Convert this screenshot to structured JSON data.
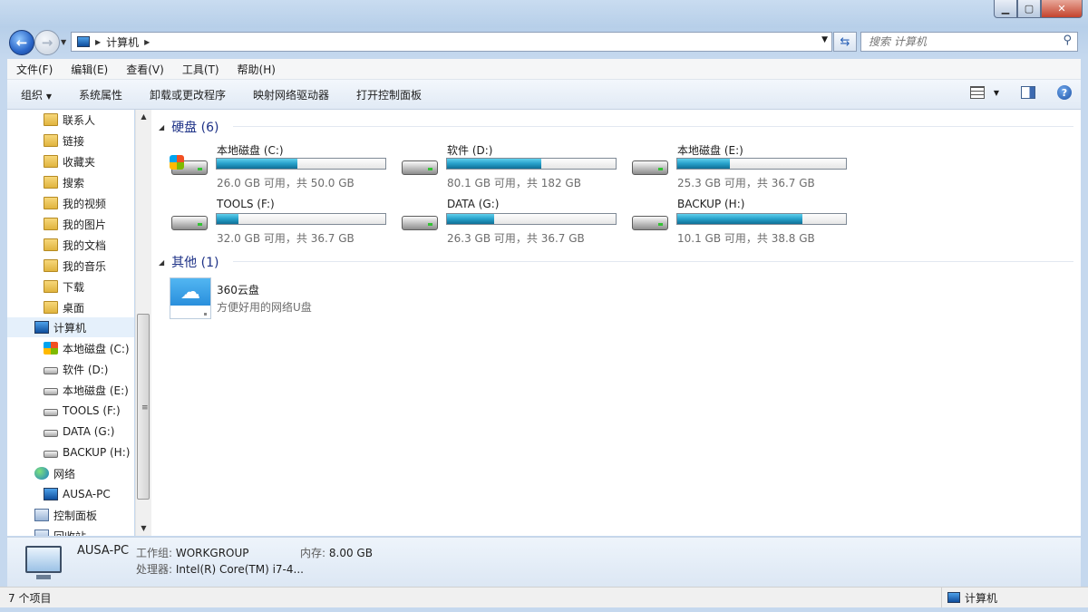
{
  "address": {
    "crumb": "计算机"
  },
  "search": {
    "placeholder": "搜索 计算机"
  },
  "menu": [
    "文件(F)",
    "编辑(E)",
    "查看(V)",
    "工具(T)",
    "帮助(H)"
  ],
  "commands": {
    "organize": "组织",
    "items": [
      "系统属性",
      "卸载或更改程序",
      "映射网络驱动器",
      "打开控制面板"
    ]
  },
  "nav": {
    "items": [
      {
        "label": "联系人",
        "icon": "contacts-icon"
      },
      {
        "label": "链接",
        "icon": "links-icon"
      },
      {
        "label": "收藏夹",
        "icon": "favorites-icon"
      },
      {
        "label": "搜索",
        "icon": "search-folder-icon"
      },
      {
        "label": "我的视频",
        "icon": "videos-icon"
      },
      {
        "label": "我的图片",
        "icon": "pictures-icon"
      },
      {
        "label": "我的文档",
        "icon": "documents-icon"
      },
      {
        "label": "我的音乐",
        "icon": "music-icon"
      },
      {
        "label": "下载",
        "icon": "downloads-icon"
      },
      {
        "label": "桌面",
        "icon": "desktop-icon"
      },
      {
        "label": "计算机",
        "icon": "computer-icon"
      },
      {
        "label": "本地磁盘 (C:)",
        "icon": "system-drive-icon"
      },
      {
        "label": "软件 (D:)",
        "icon": "drive-icon"
      },
      {
        "label": "本地磁盘 (E:)",
        "icon": "drive-icon"
      },
      {
        "label": "TOOLS (F:)",
        "icon": "drive-icon"
      },
      {
        "label": "DATA (G:)",
        "icon": "drive-icon"
      },
      {
        "label": "BACKUP (H:)",
        "icon": "drive-icon"
      },
      {
        "label": "网络",
        "icon": "network-icon"
      },
      {
        "label": "AUSA-PC",
        "icon": "computer-icon"
      },
      {
        "label": "控制面板",
        "icon": "control-panel-icon"
      },
      {
        "label": "回收站",
        "icon": "recycle-bin-icon"
      }
    ]
  },
  "groups": {
    "hard_disks": "硬盘 (6)",
    "other": "其他 (1)"
  },
  "drives": [
    {
      "name": "本地磁盘 (C:)",
      "free": "26.0 GB 可用，共 50.0 GB",
      "used_fraction": 0.48
    },
    {
      "name": "软件 (D:)",
      "free": "80.1 GB 可用，共 182 GB",
      "used_fraction": 0.56
    },
    {
      "name": "本地磁盘 (E:)",
      "free": "25.3 GB 可用，共 36.7 GB",
      "used_fraction": 0.31
    },
    {
      "name": "TOOLS (F:)",
      "free": "32.0 GB 可用，共 36.7 GB",
      "used_fraction": 0.13
    },
    {
      "name": "DATA (G:)",
      "free": "26.3 GB 可用，共 36.7 GB",
      "used_fraction": 0.28
    },
    {
      "name": "BACKUP (H:)",
      "free": "10.1 GB 可用，共 38.8 GB",
      "used_fraction": 0.74
    }
  ],
  "cloud": {
    "name": "360云盘",
    "desc": "方便好用的网络U盘"
  },
  "details": {
    "name": "AUSA-PC",
    "workgroup_label": "工作组:",
    "workgroup": "WORKGROUP",
    "memory_label": "内存:",
    "memory": "8.00 GB",
    "cpu_label": "处理器:",
    "cpu": "Intel(R) Core(TM) i7-4..."
  },
  "status": {
    "count": "7 个项目",
    "location": "计算机"
  },
  "colors": {
    "drive_fill": "#26a0c9",
    "group_header": "#1e3287"
  }
}
